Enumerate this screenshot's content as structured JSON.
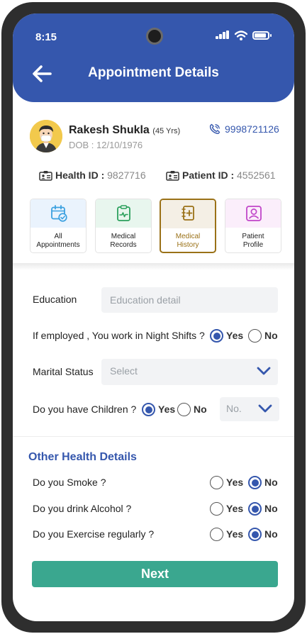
{
  "status_bar": {
    "time": "8:15"
  },
  "header": {
    "title": "Appointment Details"
  },
  "patient": {
    "name": "Rakesh Shukla",
    "age": "(45 Yrs)",
    "dob": "DOB : 12/10/1976",
    "phone": "9998721126",
    "health_id_label": "Health ID : ",
    "health_id": "9827716",
    "patient_id_label": "Patient ID : ",
    "patient_id": "4552561"
  },
  "tabs": [
    {
      "label_line1": "All",
      "label_line2": "Appointments",
      "icon": "calendar-check-icon",
      "tint": "#eaf3fd",
      "color": "#3aa0e0",
      "active": false
    },
    {
      "label_line1": "Medical",
      "label_line2": "Records",
      "icon": "clipboard-pulse-icon",
      "tint": "#e8f6ee",
      "color": "#2aa05c",
      "active": false
    },
    {
      "label_line1": "Medical",
      "label_line2": "History",
      "icon": "medical-book-icon",
      "tint": "#f4efe5",
      "color": "#9a7117",
      "active": true
    },
    {
      "label_line1": "Patient",
      "label_line2": "Profile",
      "icon": "profile-card-icon",
      "tint": "#fbeefb",
      "color": "#c146c9",
      "active": false
    }
  ],
  "form": {
    "education_label": "Education",
    "education_placeholder": "Education detail",
    "night_shift_label": "If employed , You work in Night Shifts ?",
    "marital_label": "Marital Status",
    "marital_value": "Select",
    "children_label": "Do you have Children ?",
    "children_count_placeholder": "No.",
    "yes": "Yes",
    "no": "No"
  },
  "other_health": {
    "title": "Other Health Details",
    "smoke_label": "Do you Smoke ?",
    "alcohol_label": "Do you drink Alcohol ?",
    "exercise_label": "Do you Exercise regularly ?"
  },
  "selections": {
    "night_shift": "Yes",
    "children": "Yes",
    "smoke": "No",
    "alcohol": "No",
    "exercise": "No"
  },
  "colors": {
    "primary": "#3557ad",
    "accent": "#3aa78f",
    "active_tab": "#9a7117"
  },
  "actions": {
    "next_label": "Next"
  }
}
